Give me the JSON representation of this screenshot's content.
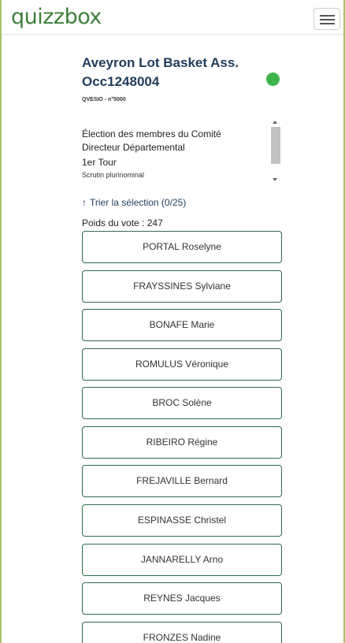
{
  "navbar": {
    "brand": "quizzbox",
    "menu_icon": "hamburger-icon"
  },
  "header": {
    "title": "Aveyron Lot Basket Ass. Occ1248004",
    "status_color": "#3eb54a",
    "reference": "QVESIO - n°5000"
  },
  "description": {
    "line1": "Élection des membres du Comité",
    "line2": "Directeur Départemental",
    "line3": "1er Tour",
    "line4": "Scrutin plurinominal"
  },
  "sort": {
    "icon": "arrow-up-icon",
    "label": "Trier la sélection (0/25)"
  },
  "vote_weight": "Poids du vote : 247",
  "candidates": [
    "PORTAL Roselyne",
    "FRAYSSINES Sylviane",
    "BONAFE Marie",
    "ROMULUS Véronique",
    "BROC Solène",
    "RIBEIRO Régine",
    "FREJAVILLE Bernard",
    "ESPINASSE Christel",
    "JANNARELLY Arno",
    "REYNES Jacques",
    "FRONZES Nadine"
  ]
}
